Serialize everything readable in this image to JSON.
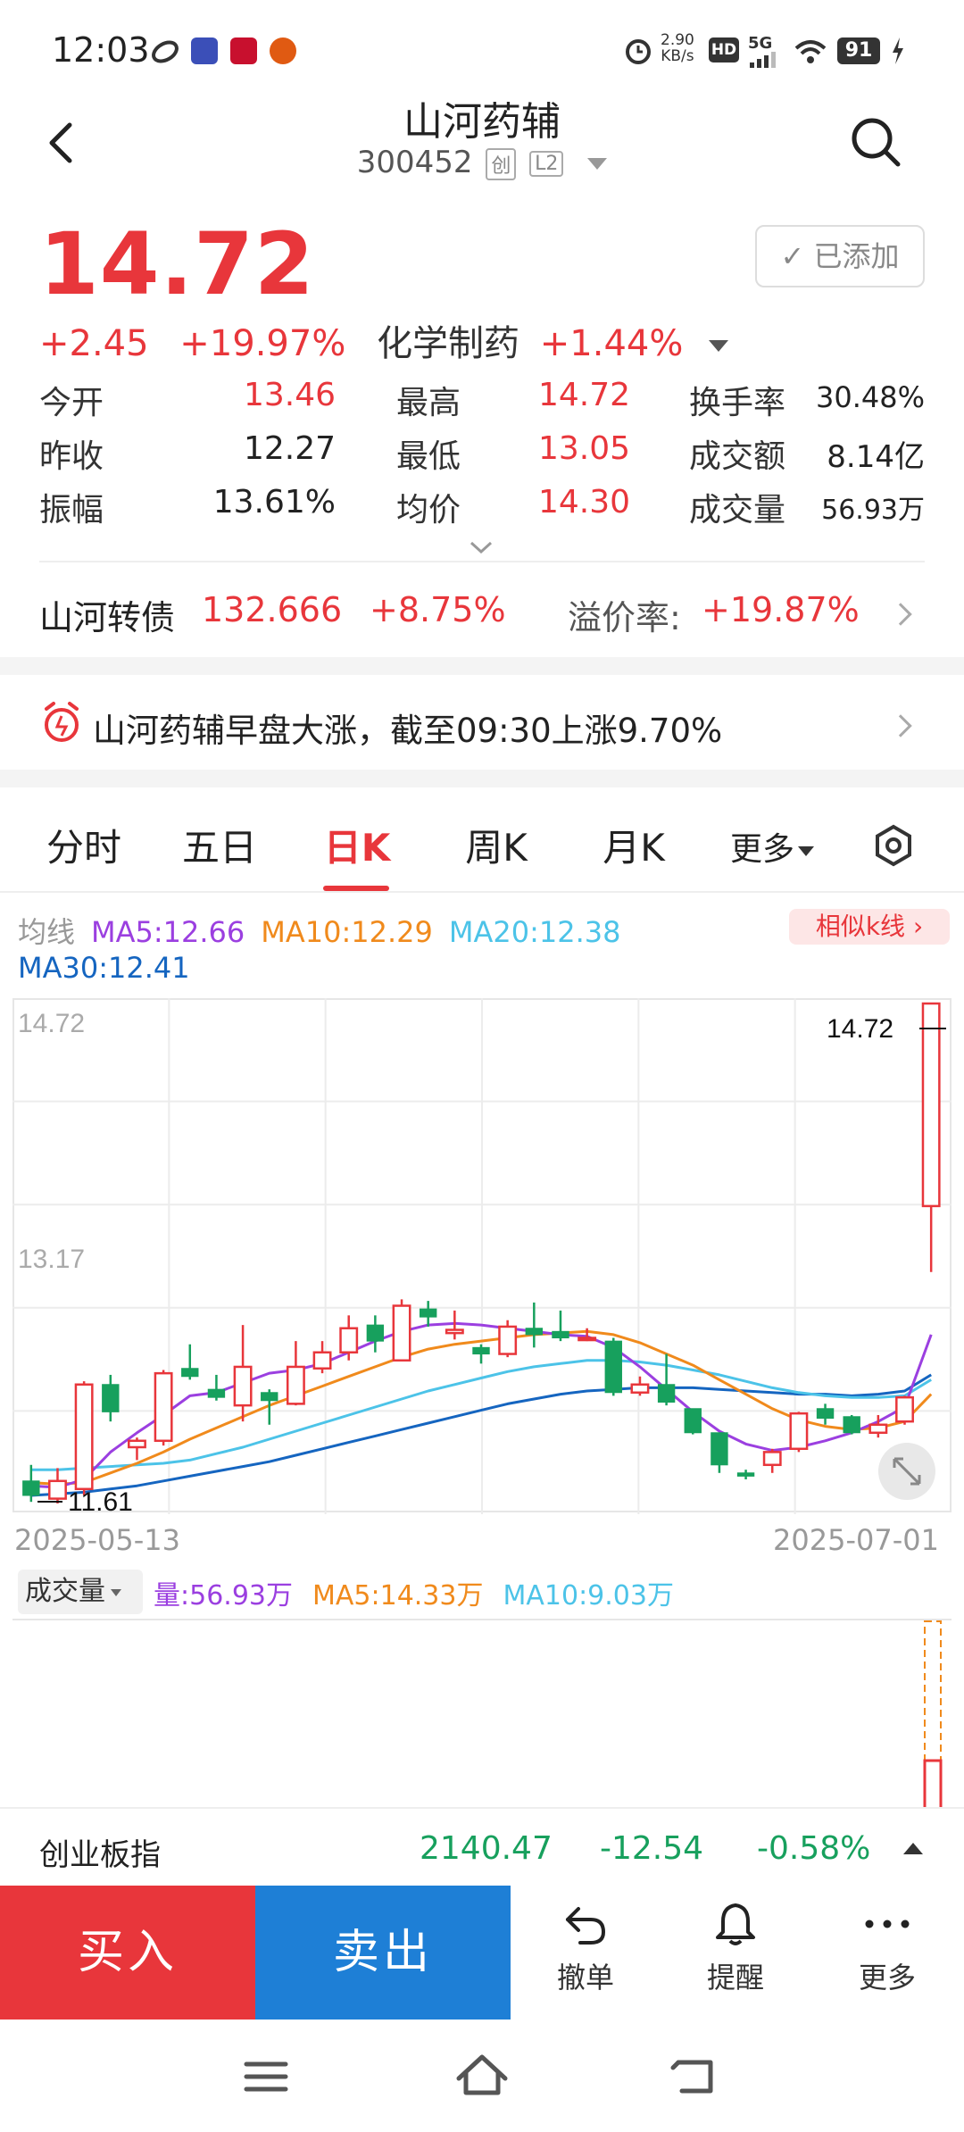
{
  "status_bar": {
    "time": "12:03",
    "net_speed_value": "2.90",
    "net_speed_unit": "KB/s",
    "hd": "HD",
    "signal": "5G",
    "battery": "91"
  },
  "header": {
    "stock_name": "山河药辅",
    "stock_code": "300452",
    "tag_chuang": "创",
    "tag_l2": "L2"
  },
  "quote": {
    "price": "14.72",
    "change": "+2.45",
    "change_pct": "+19.97%",
    "sector_name": "化学制药",
    "sector_change": "+1.44%",
    "added_label": "已添加",
    "stats": {
      "open_label": "今开",
      "open": "13.46",
      "high_label": "最高",
      "high": "14.72",
      "turnover_label": "换手率",
      "turnover": "30.48%",
      "prev_close_label": "昨收",
      "prev_close": "12.27",
      "low_label": "最低",
      "low": "13.05",
      "amount_label": "成交额",
      "amount": "8.14亿",
      "amplitude_label": "振幅",
      "amplitude": "13.61%",
      "avg_label": "均价",
      "avg": "14.30",
      "volume_label": "成交量",
      "volume": "56.93万"
    }
  },
  "bond": {
    "name": "山河转债",
    "price": "132.666",
    "change_pct": "+8.75%",
    "premium_label": "溢价率:",
    "premium": "+19.87%"
  },
  "news": {
    "text": "山河药辅早盘大涨，截至09:30上涨9.70%"
  },
  "tabs": {
    "items": [
      "分时",
      "五日",
      "日K",
      "周K",
      "月K",
      "更多"
    ],
    "active": "日K"
  },
  "ma_legend": {
    "title": "均线",
    "ma5": "MA5:12.66",
    "ma10": "MA10:12.29",
    "ma20": "MA20:12.38",
    "ma30": "MA30:12.41",
    "similar_k": "相似k线"
  },
  "colors": {
    "up": "#e8363b",
    "down": "#17a05d",
    "ma5": "#9b3fe0",
    "ma10": "#f08a1c",
    "ma20": "#4cc3e8",
    "ma30": "#1565c0",
    "sell": "#1e7fd6"
  },
  "chart_data": {
    "type": "candlestick",
    "y_labels": [
      "14.72",
      "13.17"
    ],
    "max_marker": "14.72",
    "min_marker": "11.61",
    "date_start": "2025-05-13",
    "date_end": "2025-07-01",
    "ylim": [
      11.61,
      14.72
    ],
    "candles": [
      {
        "o": 11.75,
        "c": 11.66,
        "h": 11.85,
        "l": 11.62
      },
      {
        "o": 11.64,
        "c": 11.75,
        "h": 11.83,
        "l": 11.61
      },
      {
        "o": 11.7,
        "c": 12.35,
        "h": 12.37,
        "l": 11.66
      },
      {
        "o": 12.35,
        "c": 12.18,
        "h": 12.41,
        "l": 12.12
      },
      {
        "o": 11.96,
        "c": 12.0,
        "h": 12.02,
        "l": 11.88
      },
      {
        "o": 12.0,
        "c": 12.42,
        "h": 12.44,
        "l": 11.97
      },
      {
        "o": 12.45,
        "c": 12.4,
        "h": 12.6,
        "l": 12.38
      },
      {
        "o": 12.32,
        "c": 12.27,
        "h": 12.41,
        "l": 12.25
      },
      {
        "o": 12.22,
        "c": 12.46,
        "h": 12.72,
        "l": 12.12
      },
      {
        "o": 12.3,
        "c": 12.25,
        "h": 12.32,
        "l": 12.1
      },
      {
        "o": 12.23,
        "c": 12.46,
        "h": 12.62,
        "l": 12.22
      },
      {
        "o": 12.45,
        "c": 12.55,
        "h": 12.62,
        "l": 12.42
      },
      {
        "o": 12.55,
        "c": 12.7,
        "h": 12.78,
        "l": 12.5
      },
      {
        "o": 12.72,
        "c": 12.62,
        "h": 12.78,
        "l": 12.55
      },
      {
        "o": 12.5,
        "c": 12.84,
        "h": 12.88,
        "l": 12.5
      },
      {
        "o": 12.82,
        "c": 12.77,
        "h": 12.87,
        "l": 12.71
      },
      {
        "o": 12.67,
        "c": 12.69,
        "h": 12.81,
        "l": 12.63
      },
      {
        "o": 12.58,
        "c": 12.54,
        "h": 12.6,
        "l": 12.48
      },
      {
        "o": 12.54,
        "c": 12.71,
        "h": 12.75,
        "l": 12.52
      },
      {
        "o": 12.7,
        "c": 12.66,
        "h": 12.86,
        "l": 12.58
      },
      {
        "o": 12.68,
        "c": 12.64,
        "h": 12.81,
        "l": 12.62
      },
      {
        "o": 12.64,
        "c": 12.64,
        "h": 12.7,
        "l": 12.62
      },
      {
        "o": 12.62,
        "c": 12.3,
        "h": 12.64,
        "l": 12.28
      },
      {
        "o": 12.3,
        "c": 12.35,
        "h": 12.4,
        "l": 12.28
      },
      {
        "o": 12.35,
        "c": 12.24,
        "h": 12.54,
        "l": 12.22
      },
      {
        "o": 12.2,
        "c": 12.05,
        "h": 12.2,
        "l": 12.04
      },
      {
        "o": 12.05,
        "c": 11.85,
        "h": 12.05,
        "l": 11.8
      },
      {
        "o": 11.8,
        "c": 11.78,
        "h": 11.82,
        "l": 11.76
      },
      {
        "o": 11.85,
        "c": 11.93,
        "h": 11.95,
        "l": 11.8
      },
      {
        "o": 11.95,
        "c": 12.17,
        "h": 12.18,
        "l": 11.93
      },
      {
        "o": 12.2,
        "c": 12.14,
        "h": 12.23,
        "l": 12.1
      },
      {
        "o": 12.15,
        "c": 12.05,
        "h": 12.16,
        "l": 12.04
      },
      {
        "o": 12.05,
        "c": 12.1,
        "h": 12.16,
        "l": 12.02
      },
      {
        "o": 12.12,
        "c": 12.27,
        "h": 12.28,
        "l": 12.1
      },
      {
        "o": 13.46,
        "c": 14.72,
        "h": 14.72,
        "l": 13.05
      }
    ],
    "ma5": [
      11.72,
      11.71,
      11.76,
      11.93,
      12.05,
      12.16,
      12.28,
      12.3,
      12.36,
      12.42,
      12.44,
      12.48,
      12.55,
      12.62,
      12.68,
      12.72,
      12.73,
      12.72,
      12.7,
      12.68,
      12.66,
      12.65,
      12.58,
      12.46,
      12.32,
      12.18,
      12.06,
      11.98,
      11.94,
      11.96,
      12.0,
      12.05,
      12.12,
      12.21,
      12.66
    ],
    "ma10": [
      11.74,
      11.73,
      11.74,
      11.8,
      11.86,
      11.93,
      12.01,
      12.08,
      12.15,
      12.22,
      12.28,
      12.34,
      12.4,
      12.46,
      12.52,
      12.57,
      12.6,
      12.62,
      12.64,
      12.66,
      12.67,
      12.68,
      12.66,
      12.61,
      12.54,
      12.47,
      12.38,
      12.29,
      12.2,
      12.13,
      12.09,
      12.07,
      12.08,
      12.12,
      12.29
    ],
    "ma20": [
      11.82,
      11.82,
      11.83,
      11.84,
      11.85,
      11.86,
      11.88,
      11.92,
      11.96,
      12.01,
      12.06,
      12.11,
      12.16,
      12.21,
      12.26,
      12.31,
      12.35,
      12.39,
      12.43,
      12.46,
      12.48,
      12.5,
      12.5,
      12.49,
      12.47,
      12.44,
      12.41,
      12.37,
      12.33,
      12.3,
      12.28,
      12.27,
      12.27,
      12.28,
      12.38
    ],
    "ma30": [
      11.66,
      11.67,
      11.68,
      11.7,
      11.72,
      11.75,
      11.78,
      11.81,
      11.84,
      11.87,
      11.91,
      11.95,
      11.99,
      12.03,
      12.07,
      12.11,
      12.15,
      12.19,
      12.23,
      12.26,
      12.29,
      12.31,
      12.32,
      12.33,
      12.33,
      12.33,
      12.32,
      12.31,
      12.3,
      12.29,
      12.29,
      12.28,
      12.29,
      12.31,
      12.41
    ]
  },
  "volume": {
    "selector": "成交量",
    "vol": "量:56.93万",
    "ma5": "MA5:14.33万",
    "ma10": "MA10:9.03万"
  },
  "index_bar": {
    "name": "创业板指",
    "value": "2140.47",
    "change": "-12.54",
    "change_pct": "-0.58%"
  },
  "actions": {
    "buy": "买入",
    "sell": "卖出",
    "cancel": "撤单",
    "alert": "提醒",
    "more": "更多"
  }
}
